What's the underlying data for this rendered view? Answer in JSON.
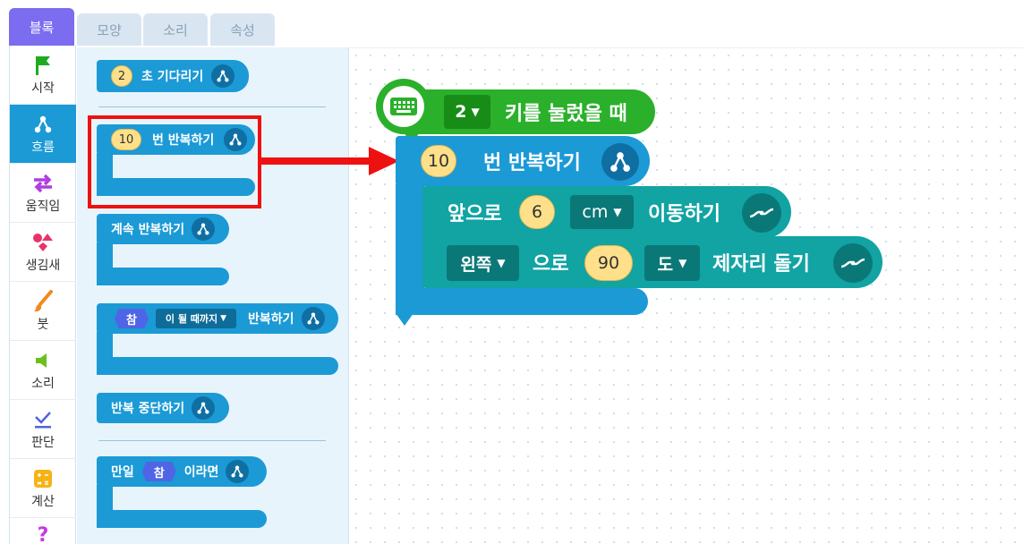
{
  "tabs": [
    {
      "label": "블록",
      "active": true
    },
    {
      "label": "모양",
      "active": false
    },
    {
      "label": "소리",
      "active": false
    },
    {
      "label": "속성",
      "active": false
    }
  ],
  "categories": [
    {
      "label": "시작",
      "icon": "flag-icon",
      "active": false
    },
    {
      "label": "흐름",
      "icon": "flow-icon",
      "active": true
    },
    {
      "label": "움직임",
      "icon": "arrows-icon",
      "active": false
    },
    {
      "label": "생김새",
      "icon": "shapes-icon",
      "active": false
    },
    {
      "label": "붓",
      "icon": "brush-icon",
      "active": false
    },
    {
      "label": "소리",
      "icon": "speaker-icon",
      "active": false
    },
    {
      "label": "판단",
      "icon": "check-icon",
      "active": false
    },
    {
      "label": "계산",
      "icon": "calculator-icon",
      "active": false
    },
    {
      "label": "",
      "icon": "question-icon",
      "active": false
    }
  ],
  "palette": {
    "wait": {
      "value": "2",
      "text": "초 기다리기"
    },
    "repeat_n": {
      "value": "10",
      "text": "번 반복하기"
    },
    "repeat_forever": {
      "text": "계속 반복하기"
    },
    "repeat_until": {
      "cond": "참",
      "dropdown": "이 될 때까지",
      "text": "반복하기"
    },
    "break": {
      "text": "반복 중단하기"
    },
    "if": {
      "prefix": "만일",
      "cond": "참",
      "suffix": "이라면"
    }
  },
  "script": {
    "event": {
      "key": "2",
      "text": "키를 눌렀을 때"
    },
    "repeat": {
      "value": "10",
      "text": "번 반복하기"
    },
    "move": {
      "prefix": "앞으로",
      "value": "6",
      "unit": "cm",
      "suffix": "이동하기"
    },
    "rotate": {
      "direction": "왼쪽",
      "mid": "으로",
      "value": "90",
      "unit": "도",
      "suffix": "제자리 돌기"
    }
  },
  "colors": {
    "flow": "#1b9ad6",
    "move": "#12a3a3",
    "event": "#2bb02b",
    "highlight": "#ee1111",
    "tab_active": "#7b6cf0"
  }
}
